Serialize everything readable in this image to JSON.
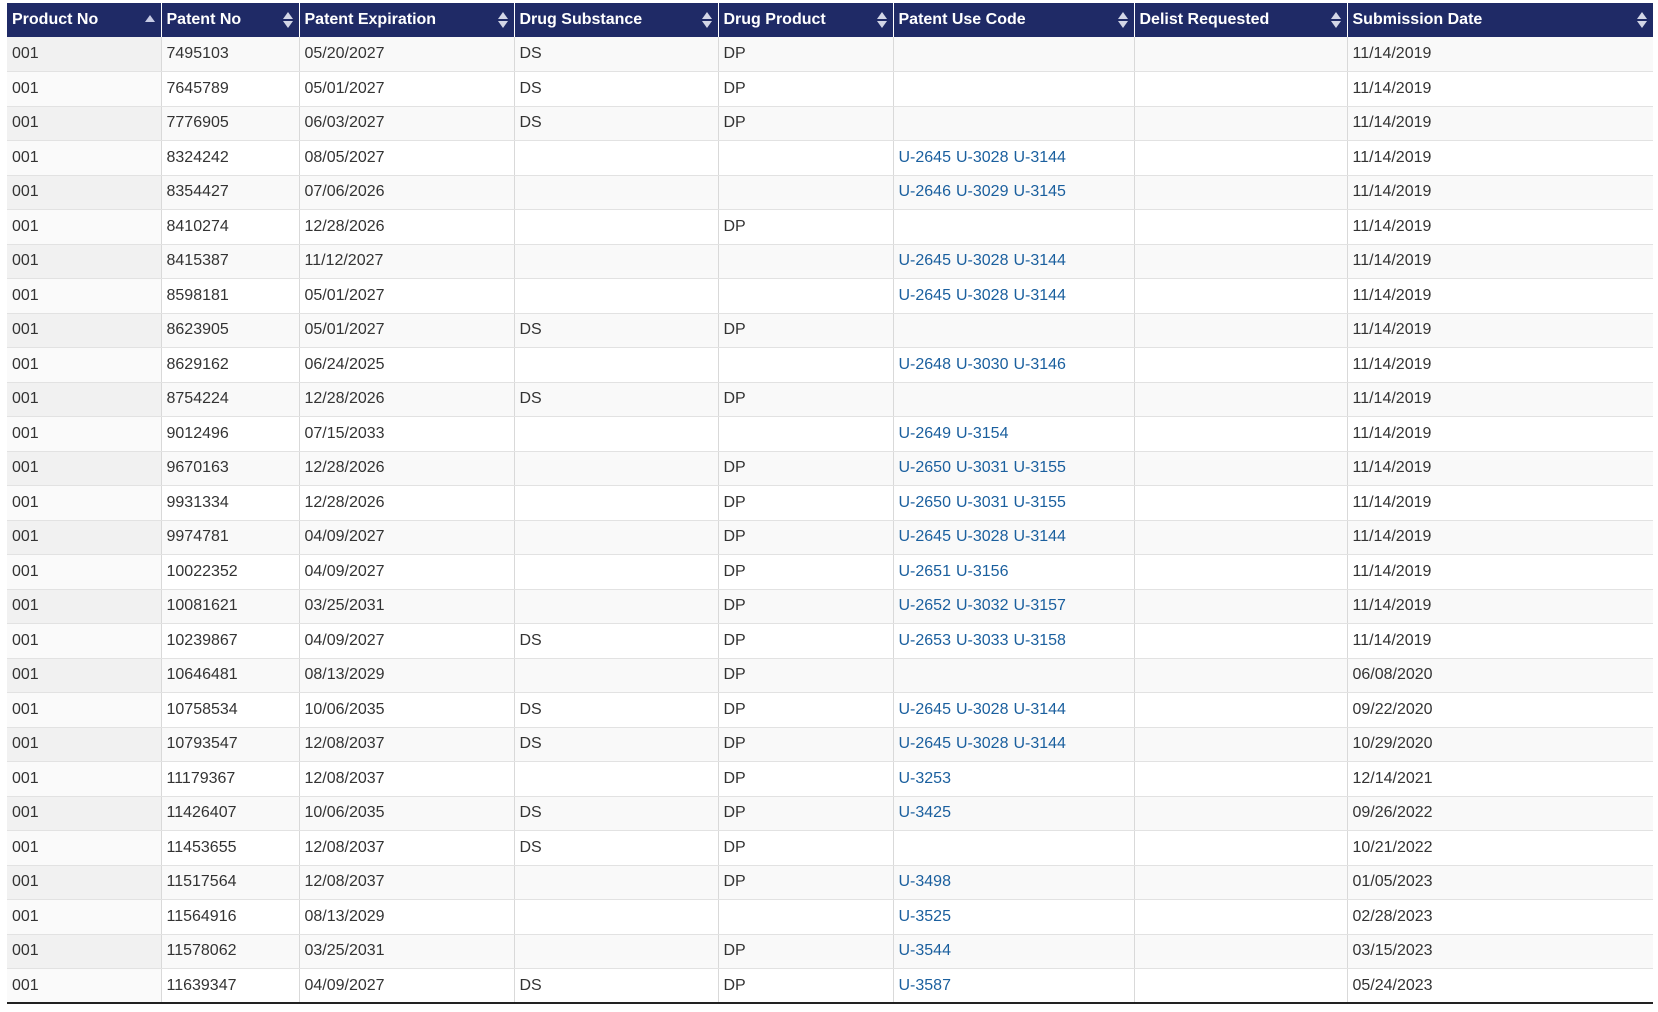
{
  "table": {
    "headers": [
      {
        "label": "Product No",
        "sort": "asc"
      },
      {
        "label": "Patent No",
        "sort": "none"
      },
      {
        "label": "Patent Expiration",
        "sort": "none"
      },
      {
        "label": "Drug Substance",
        "sort": "none"
      },
      {
        "label": "Drug Product",
        "sort": "none"
      },
      {
        "label": "Patent Use Code",
        "sort": "none"
      },
      {
        "label": "Delist Requested",
        "sort": "none"
      },
      {
        "label": "Submission Date",
        "sort": "none"
      }
    ],
    "rows": [
      {
        "product_no": "001",
        "patent_no": "7495103",
        "expiration": "05/20/2027",
        "drug_substance": "DS",
        "drug_product": "DP",
        "use_codes": [],
        "delist": "",
        "submission": "11/14/2019"
      },
      {
        "product_no": "001",
        "patent_no": "7645789",
        "expiration": "05/01/2027",
        "drug_substance": "DS",
        "drug_product": "DP",
        "use_codes": [],
        "delist": "",
        "submission": "11/14/2019"
      },
      {
        "product_no": "001",
        "patent_no": "7776905",
        "expiration": "06/03/2027",
        "drug_substance": "DS",
        "drug_product": "DP",
        "use_codes": [],
        "delist": "",
        "submission": "11/14/2019"
      },
      {
        "product_no": "001",
        "patent_no": "8324242",
        "expiration": "08/05/2027",
        "drug_substance": "",
        "drug_product": "",
        "use_codes": [
          "U-2645",
          "U-3028",
          "U-3144"
        ],
        "delist": "",
        "submission": "11/14/2019"
      },
      {
        "product_no": "001",
        "patent_no": "8354427",
        "expiration": "07/06/2026",
        "drug_substance": "",
        "drug_product": "",
        "use_codes": [
          "U-2646",
          "U-3029",
          "U-3145"
        ],
        "delist": "",
        "submission": "11/14/2019"
      },
      {
        "product_no": "001",
        "patent_no": "8410274",
        "expiration": "12/28/2026",
        "drug_substance": "",
        "drug_product": "DP",
        "use_codes": [],
        "delist": "",
        "submission": "11/14/2019"
      },
      {
        "product_no": "001",
        "patent_no": "8415387",
        "expiration": "11/12/2027",
        "drug_substance": "",
        "drug_product": "",
        "use_codes": [
          "U-2645",
          "U-3028",
          "U-3144"
        ],
        "delist": "",
        "submission": "11/14/2019"
      },
      {
        "product_no": "001",
        "patent_no": "8598181",
        "expiration": "05/01/2027",
        "drug_substance": "",
        "drug_product": "",
        "use_codes": [
          "U-2645",
          "U-3028",
          "U-3144"
        ],
        "delist": "",
        "submission": "11/14/2019"
      },
      {
        "product_no": "001",
        "patent_no": "8623905",
        "expiration": "05/01/2027",
        "drug_substance": "DS",
        "drug_product": "DP",
        "use_codes": [],
        "delist": "",
        "submission": "11/14/2019"
      },
      {
        "product_no": "001",
        "patent_no": "8629162",
        "expiration": "06/24/2025",
        "drug_substance": "",
        "drug_product": "",
        "use_codes": [
          "U-2648",
          "U-3030",
          "U-3146"
        ],
        "delist": "",
        "submission": "11/14/2019"
      },
      {
        "product_no": "001",
        "patent_no": "8754224",
        "expiration": "12/28/2026",
        "drug_substance": "DS",
        "drug_product": "DP",
        "use_codes": [],
        "delist": "",
        "submission": "11/14/2019"
      },
      {
        "product_no": "001",
        "patent_no": "9012496",
        "expiration": "07/15/2033",
        "drug_substance": "",
        "drug_product": "",
        "use_codes": [
          "U-2649",
          "U-3154"
        ],
        "delist": "",
        "submission": "11/14/2019"
      },
      {
        "product_no": "001",
        "patent_no": "9670163",
        "expiration": "12/28/2026",
        "drug_substance": "",
        "drug_product": "DP",
        "use_codes": [
          "U-2650",
          "U-3031",
          "U-3155"
        ],
        "delist": "",
        "submission": "11/14/2019"
      },
      {
        "product_no": "001",
        "patent_no": "9931334",
        "expiration": "12/28/2026",
        "drug_substance": "",
        "drug_product": "DP",
        "use_codes": [
          "U-2650",
          "U-3031",
          "U-3155"
        ],
        "delist": "",
        "submission": "11/14/2019"
      },
      {
        "product_no": "001",
        "patent_no": "9974781",
        "expiration": "04/09/2027",
        "drug_substance": "",
        "drug_product": "DP",
        "use_codes": [
          "U-2645",
          "U-3028",
          "U-3144"
        ],
        "delist": "",
        "submission": "11/14/2019"
      },
      {
        "product_no": "001",
        "patent_no": "10022352",
        "expiration": "04/09/2027",
        "drug_substance": "",
        "drug_product": "DP",
        "use_codes": [
          "U-2651",
          "U-3156"
        ],
        "delist": "",
        "submission": "11/14/2019"
      },
      {
        "product_no": "001",
        "patent_no": "10081621",
        "expiration": "03/25/2031",
        "drug_substance": "",
        "drug_product": "DP",
        "use_codes": [
          "U-2652",
          "U-3032",
          "U-3157"
        ],
        "delist": "",
        "submission": "11/14/2019"
      },
      {
        "product_no": "001",
        "patent_no": "10239867",
        "expiration": "04/09/2027",
        "drug_substance": "DS",
        "drug_product": "DP",
        "use_codes": [
          "U-2653",
          "U-3033",
          "U-3158"
        ],
        "delist": "",
        "submission": "11/14/2019"
      },
      {
        "product_no": "001",
        "patent_no": "10646481",
        "expiration": "08/13/2029",
        "drug_substance": "",
        "drug_product": "DP",
        "use_codes": [],
        "delist": "",
        "submission": "06/08/2020"
      },
      {
        "product_no": "001",
        "patent_no": "10758534",
        "expiration": "10/06/2035",
        "drug_substance": "DS",
        "drug_product": "DP",
        "use_codes": [
          "U-2645",
          "U-3028",
          "U-3144"
        ],
        "delist": "",
        "submission": "09/22/2020"
      },
      {
        "product_no": "001",
        "patent_no": "10793547",
        "expiration": "12/08/2037",
        "drug_substance": "DS",
        "drug_product": "DP",
        "use_codes": [
          "U-2645",
          "U-3028",
          "U-3144"
        ],
        "delist": "",
        "submission": "10/29/2020"
      },
      {
        "product_no": "001",
        "patent_no": "11179367",
        "expiration": "12/08/2037",
        "drug_substance": "",
        "drug_product": "DP",
        "use_codes": [
          "U-3253"
        ],
        "delist": "",
        "submission": "12/14/2021"
      },
      {
        "product_no": "001",
        "patent_no": "11426407",
        "expiration": "10/06/2035",
        "drug_substance": "DS",
        "drug_product": "DP",
        "use_codes": [
          "U-3425"
        ],
        "delist": "",
        "submission": "09/26/2022"
      },
      {
        "product_no": "001",
        "patent_no": "11453655",
        "expiration": "12/08/2037",
        "drug_substance": "DS",
        "drug_product": "DP",
        "use_codes": [],
        "delist": "",
        "submission": "10/21/2022"
      },
      {
        "product_no": "001",
        "patent_no": "11517564",
        "expiration": "12/08/2037",
        "drug_substance": "",
        "drug_product": "DP",
        "use_codes": [
          "U-3498"
        ],
        "delist": "",
        "submission": "01/05/2023"
      },
      {
        "product_no": "001",
        "patent_no": "11564916",
        "expiration": "08/13/2029",
        "drug_substance": "",
        "drug_product": "",
        "use_codes": [
          "U-3525"
        ],
        "delist": "",
        "submission": "02/28/2023"
      },
      {
        "product_no": "001",
        "patent_no": "11578062",
        "expiration": "03/25/2031",
        "drug_substance": "",
        "drug_product": "DP",
        "use_codes": [
          "U-3544"
        ],
        "delist": "",
        "submission": "03/15/2023"
      },
      {
        "product_no": "001",
        "patent_no": "11639347",
        "expiration": "04/09/2027",
        "drug_substance": "DS",
        "drug_product": "DP",
        "use_codes": [
          "U-3587"
        ],
        "delist": "",
        "submission": "05/24/2023"
      }
    ]
  },
  "colors": {
    "header_bg": "#1f2a66",
    "header_text": "#ffffff",
    "link": "#1a5f9e",
    "row_odd": "#f9f9f9",
    "row_even": "#ffffff"
  }
}
